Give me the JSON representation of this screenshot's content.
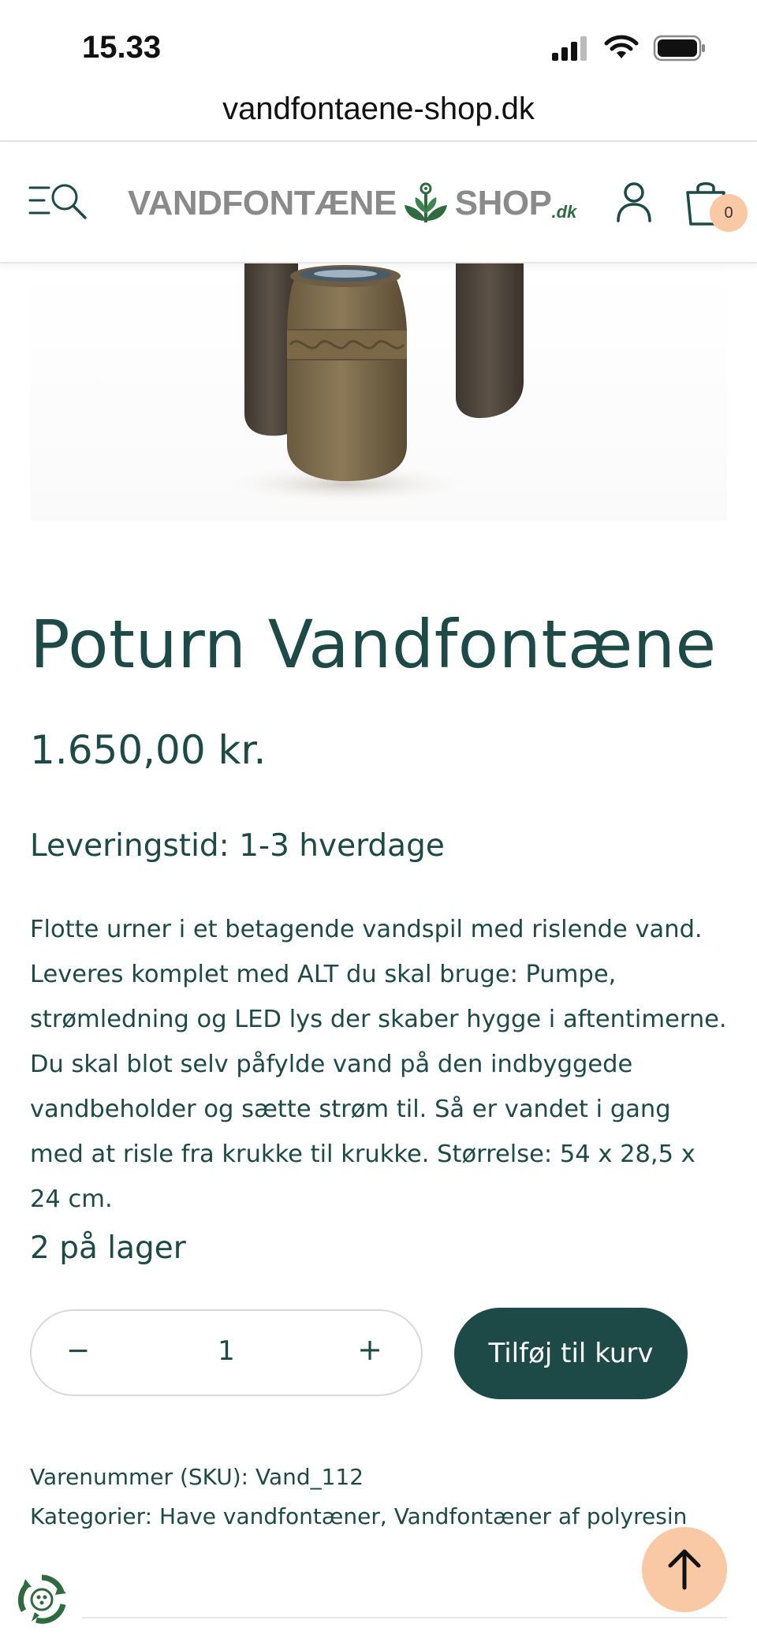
{
  "status_bar": {
    "time": "15.33",
    "url": "vandfontaene-shop.dk"
  },
  "header": {
    "logo_left": "VANDFONTÆNE",
    "logo_right": "SHOP",
    "logo_suffix": ".dk",
    "cart_count": "0"
  },
  "product": {
    "title": "Poturn Vandfontæne",
    "price": "1.650,00 kr.",
    "delivery": "Leveringstid: 1-3 hverdage",
    "description": "Flotte urner i et betagende vandspil med rislende vand. Leveres komplet med ALT du skal bruge: Pumpe, strømledning og LED lys der skaber hygge i aftentimerne. Du skal blot selv påfylde vand på den indbyggede vandbeholder og sætte strøm til. Så er vandet i gang med at risle fra krukke til krukke. Størrelse: 54 x 28,5 x 24 cm.",
    "stock": "2 på lager",
    "quantity": "1",
    "qty_minus": "−",
    "qty_plus": "+",
    "add_to_cart": "Tilføj til kurv",
    "sku_label": "Varenummer (SKU):",
    "sku_value": "Vand_112",
    "categories_label": "Kategorier:",
    "categories": [
      "Have vandfontæner",
      "Vandfontæner af polyresin"
    ]
  },
  "colors": {
    "brand": "#1d4a47",
    "accent": "#f9c9a6"
  },
  "icons": [
    "signal-icon",
    "wifi-icon",
    "battery-icon",
    "menu-icon",
    "search-icon",
    "user-icon",
    "cart-icon",
    "arrow-up-icon",
    "recycle-icon"
  ]
}
